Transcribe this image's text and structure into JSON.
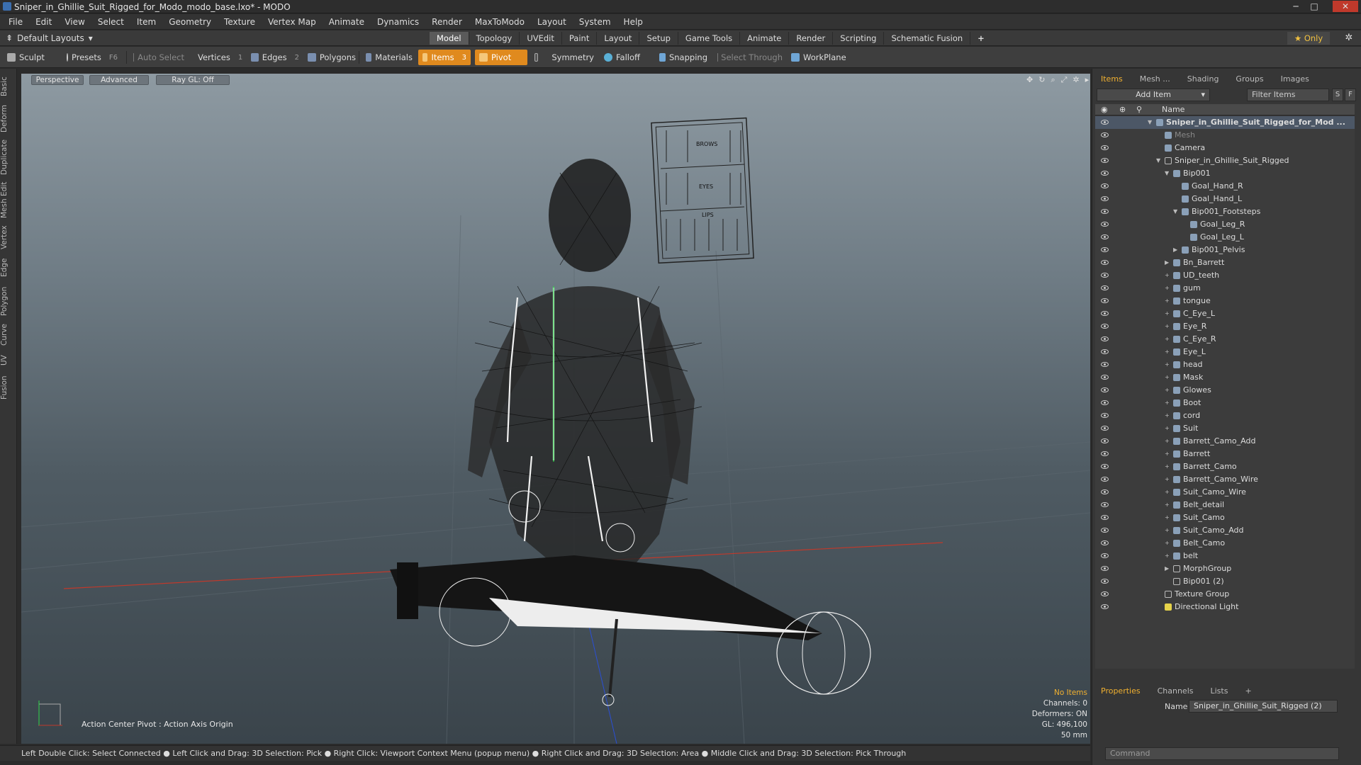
{
  "window": {
    "title": "Sniper_in_Ghillie_Suit_Rigged_for_Modo_modo_base.lxo* - MODO",
    "minimize": "─",
    "maximize": "□",
    "close": "✕"
  },
  "menu": [
    "File",
    "Edit",
    "View",
    "Select",
    "Item",
    "Geometry",
    "Texture",
    "Vertex Map",
    "Animate",
    "Dynamics",
    "Render",
    "MaxToModo",
    "Layout",
    "System",
    "Help"
  ],
  "layoutbar": {
    "layout": "Default Layouts",
    "tabs": [
      "Model",
      "Topology",
      "UVEdit",
      "Paint",
      "Layout",
      "Setup",
      "Game Tools",
      "Animate",
      "Render",
      "Scripting",
      "Schematic Fusion",
      "+"
    ],
    "active_tab": "Model",
    "only": "Only",
    "star": "★"
  },
  "toolbar": {
    "sculpt": "Sculpt",
    "presets": "Presets",
    "presets_key": "F6",
    "auto_select": "Auto Select",
    "vertices": "Vertices",
    "vertices_count": "1",
    "edges": "Edges",
    "edges_count": "2",
    "polygons": "Polygons",
    "materials": "Materials",
    "items": "Items",
    "items_count": "3",
    "pivot": "Pivot",
    "symmetry": "Symmetry",
    "falloff": "Falloff",
    "snapping": "Snapping",
    "select_through": "Select Through",
    "workplane": "WorkPlane"
  },
  "lefttabs": [
    "Basic",
    "Deform",
    "Duplicate",
    "Mesh Edit",
    "Vertex",
    "Edge",
    "Polygon",
    "Curve",
    "UV",
    "Fusion"
  ],
  "viewport": {
    "view": "Perspective",
    "advanced": "Advanced",
    "raygl": "Ray GL: Off",
    "action_center": "Action Center Pivot : Action Axis Origin",
    "face_labels": [
      "BROWS",
      "EYES",
      "LIPS"
    ],
    "info": {
      "no_items": "No Items",
      "channels": "Channels: 0",
      "deformers": "Deformers: ON",
      "gl": "GL: 496,100",
      "focal": "50 mm"
    }
  },
  "statusbar": "Left Double Click: Select Connected ● Left Click and Drag: 3D Selection: Pick ● Right Click: Viewport Context Menu (popup menu) ● Right Click and Drag: 3D Selection: Area ● Middle Click and Drag: 3D Selection: Pick Through",
  "panel": {
    "tabs": [
      "Items",
      "Mesh ...",
      "Shading",
      "Groups",
      "Images"
    ],
    "active_tab": "Items",
    "add_item": "Add Item",
    "filter": "Filter Items",
    "s_btn": "S",
    "f_btn": "F",
    "name_col": "Name",
    "items": [
      {
        "label": "Sniper_in_Ghillie_Suit_Rigged_for_Mod ...",
        "depth": 0,
        "exp": "▼",
        "bold": true
      },
      {
        "label": "Mesh",
        "depth": 1,
        "dim": true
      },
      {
        "label": "Camera",
        "depth": 1
      },
      {
        "label": "Sniper_in_Ghillie_Suit_Rigged",
        "depth": 1,
        "exp": "▼",
        "loc": true
      },
      {
        "label": "Bip001",
        "depth": 2,
        "exp": "▼"
      },
      {
        "label": "Goal_Hand_R",
        "depth": 3
      },
      {
        "label": "Goal_Hand_L",
        "depth": 3
      },
      {
        "label": "Bip001_Footsteps",
        "depth": 3,
        "exp": "▼"
      },
      {
        "label": "Goal_Leg_R",
        "depth": 4
      },
      {
        "label": "Goal_Leg_L",
        "depth": 4
      },
      {
        "label": "Bip001_Pelvis",
        "depth": 3,
        "exp": "▶"
      },
      {
        "label": "Bn_Barrett",
        "depth": 2,
        "exp": "▶"
      },
      {
        "label": "UD_teeth",
        "depth": 2,
        "exp": "+"
      },
      {
        "label": "gum",
        "depth": 2,
        "exp": "+"
      },
      {
        "label": "tongue",
        "depth": 2,
        "exp": "+"
      },
      {
        "label": "C_Eye_L",
        "depth": 2,
        "exp": "+"
      },
      {
        "label": "Eye_R",
        "depth": 2,
        "exp": "+"
      },
      {
        "label": "C_Eye_R",
        "depth": 2,
        "exp": "+"
      },
      {
        "label": "Eye_L",
        "depth": 2,
        "exp": "+"
      },
      {
        "label": "head",
        "depth": 2,
        "exp": "+"
      },
      {
        "label": "Mask",
        "depth": 2,
        "exp": "+"
      },
      {
        "label": "Glowes",
        "depth": 2,
        "exp": "+"
      },
      {
        "label": "Boot",
        "depth": 2,
        "exp": "+"
      },
      {
        "label": "cord",
        "depth": 2,
        "exp": "+"
      },
      {
        "label": "Suit",
        "depth": 2,
        "exp": "+"
      },
      {
        "label": "Barrett_Camo_Add",
        "depth": 2,
        "exp": "+"
      },
      {
        "label": "Barrett",
        "depth": 2,
        "exp": "+"
      },
      {
        "label": "Barrett_Camo",
        "depth": 2,
        "exp": "+"
      },
      {
        "label": "Barrett_Camo_Wire",
        "depth": 2,
        "exp": "+"
      },
      {
        "label": "Suit_Camo_Wire",
        "depth": 2,
        "exp": "+"
      },
      {
        "label": "Belt_detail",
        "depth": 2,
        "exp": "+"
      },
      {
        "label": "Suit_Camo",
        "depth": 2,
        "exp": "+"
      },
      {
        "label": "Suit_Camo_Add",
        "depth": 2,
        "exp": "+"
      },
      {
        "label": "Belt_Camo",
        "depth": 2,
        "exp": "+"
      },
      {
        "label": "belt",
        "depth": 2,
        "exp": "+"
      },
      {
        "label": "MorphGroup",
        "depth": 2,
        "exp": "▶",
        "loc": true
      },
      {
        "label": "Bip001 (2)",
        "depth": 2,
        "loc": true
      },
      {
        "label": "Texture Group",
        "depth": 1,
        "loc": true
      },
      {
        "label": "Directional Light",
        "depth": 1,
        "light": true
      }
    ],
    "prop_tabs": [
      "Properties",
      "Channels",
      "Lists",
      "+"
    ],
    "active_prop_tab": "Properties",
    "name_label": "Name",
    "name_value": "Sniper_in_Ghillie_Suit_Rigged (2)",
    "command": "Command"
  }
}
